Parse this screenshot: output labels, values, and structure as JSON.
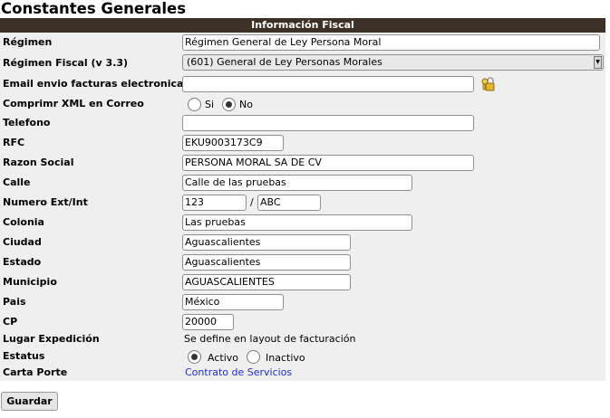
{
  "page": {
    "title": "Constantes Generales"
  },
  "section": {
    "header": "Información Fiscal"
  },
  "labels": {
    "regimen": "Régimen",
    "regimen_fiscal": "Régimen Fiscal (v 3.3)",
    "email": "Email envio facturas electronicas",
    "comprimir": "Comprimr XML en Correo",
    "telefono": "Telefono",
    "rfc": "RFC",
    "razon_social": "Razon Social",
    "calle": "Calle",
    "numero": "Numero Ext/Int",
    "colonia": "Colonia",
    "ciudad": "Ciudad",
    "estado": "Estado",
    "municipio": "Municipio",
    "pais": "Pais",
    "cp": "CP",
    "lugar_expedicion": "Lugar Expedición",
    "estatus": "Estatus",
    "carta_porte": "Carta Porte"
  },
  "fields": {
    "regimen": "Régimen General de Ley Persona Moral",
    "regimen_fiscal_selected": "(601) General de Ley Personas Morales",
    "email": "",
    "telefono": "",
    "rfc": "EKU9003173C9",
    "razon_social": "PERSONA MORAL SA DE CV",
    "calle": "Calle de las pruebas",
    "numero_ext": "123",
    "numero_separator": "/",
    "numero_int": "ABC",
    "colonia": "Las pruebas",
    "ciudad": "Aguascalientes",
    "estado": "Aguascalientes",
    "municipio": "AGUASCALIENTES",
    "pais": "México",
    "cp": "20000",
    "lugar_expedicion_text": "Se define en layout de facturación",
    "carta_porte_link": "Contrato de Servicios"
  },
  "comprimir_options": {
    "si": "Si",
    "no": "No",
    "selected": "no"
  },
  "estatus_options": {
    "activo": "Activo",
    "inactivo": "Inactivo",
    "selected": "activo"
  },
  "buttons": {
    "save": "Guardar"
  },
  "icons": {
    "email_key": "key-lock-icon"
  },
  "colors": {
    "header_bg": "#3d3127",
    "panel_bg": "#efefef",
    "link": "#1f2fcf"
  }
}
